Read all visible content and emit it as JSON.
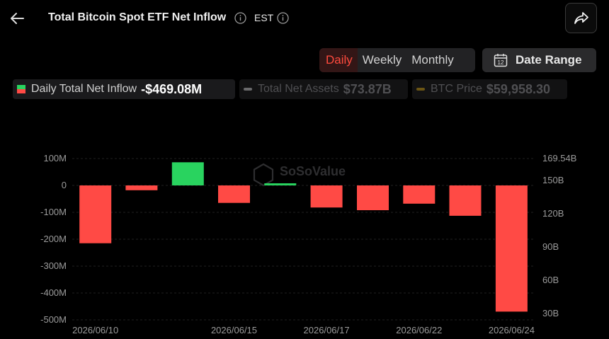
{
  "header": {
    "title": "Total Bitcoin Spot ETF Net Inflow",
    "timezone": "EST"
  },
  "period_tabs": [
    {
      "label": "Daily",
      "active": true
    },
    {
      "label": "Weekly",
      "active": false
    },
    {
      "label": "Monthly",
      "active": false
    }
  ],
  "date_range": {
    "label": "Date Range",
    "icon_day": "12"
  },
  "legend": {
    "daily": {
      "label": "Daily Total Net Inflow",
      "value": "-$469.08M"
    },
    "assets": {
      "label": "Total Net Assets",
      "value": "$73.87B"
    },
    "btc": {
      "label": "BTC Price",
      "value": "$59,958.30"
    }
  },
  "watermark": "SoSoValue",
  "colors": {
    "positive": "#29d35f",
    "negative": "#ff4a45",
    "assets_line": "#8a8a8a",
    "btc_line": "#8a6a12"
  },
  "chart_data": {
    "type": "bar",
    "y_left": {
      "ticks": [
        "100M",
        "0",
        "-100M",
        "-200M",
        "-300M",
        "-400M",
        "-500M"
      ],
      "range": [
        -500,
        100
      ],
      "unit": "M"
    },
    "y_right": {
      "ticks": [
        "169.54B",
        "150B",
        "120B",
        "90B",
        "60B",
        "30B"
      ]
    },
    "x_labels": [
      "2026/06/10",
      "2026/06/15",
      "2026/06/17",
      "2026/06/22",
      "2026/06/24"
    ],
    "values": [
      -215,
      -18,
      86,
      -65,
      8,
      -82,
      -92,
      -68,
      -113,
      -469.08
    ],
    "grid": true
  }
}
